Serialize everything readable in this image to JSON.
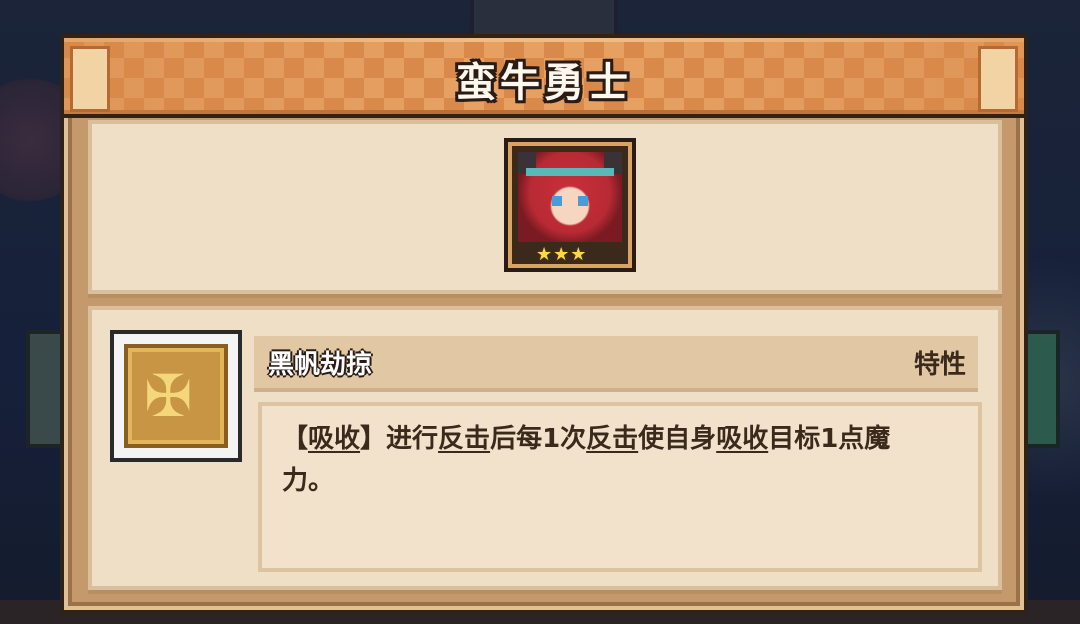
{
  "card": {
    "title": "蛮牛勇士",
    "stars": "★★★"
  },
  "skill": {
    "name": "黑帆劫掠",
    "type": "特性",
    "description": {
      "p1": "【",
      "k1": "吸收",
      "p2": "】进行",
      "k2": "反击",
      "p3": "后每1次",
      "k3": "反击",
      "p4": "使自身",
      "k4": "吸收",
      "p5": "目标1点魔力。"
    },
    "icon": "crossed-figure-icon"
  },
  "colors": {
    "panel": "#c49a6c",
    "header": "#d98a4b",
    "content_bg": "#f0dfc7",
    "skill_icon": "#c79544"
  }
}
